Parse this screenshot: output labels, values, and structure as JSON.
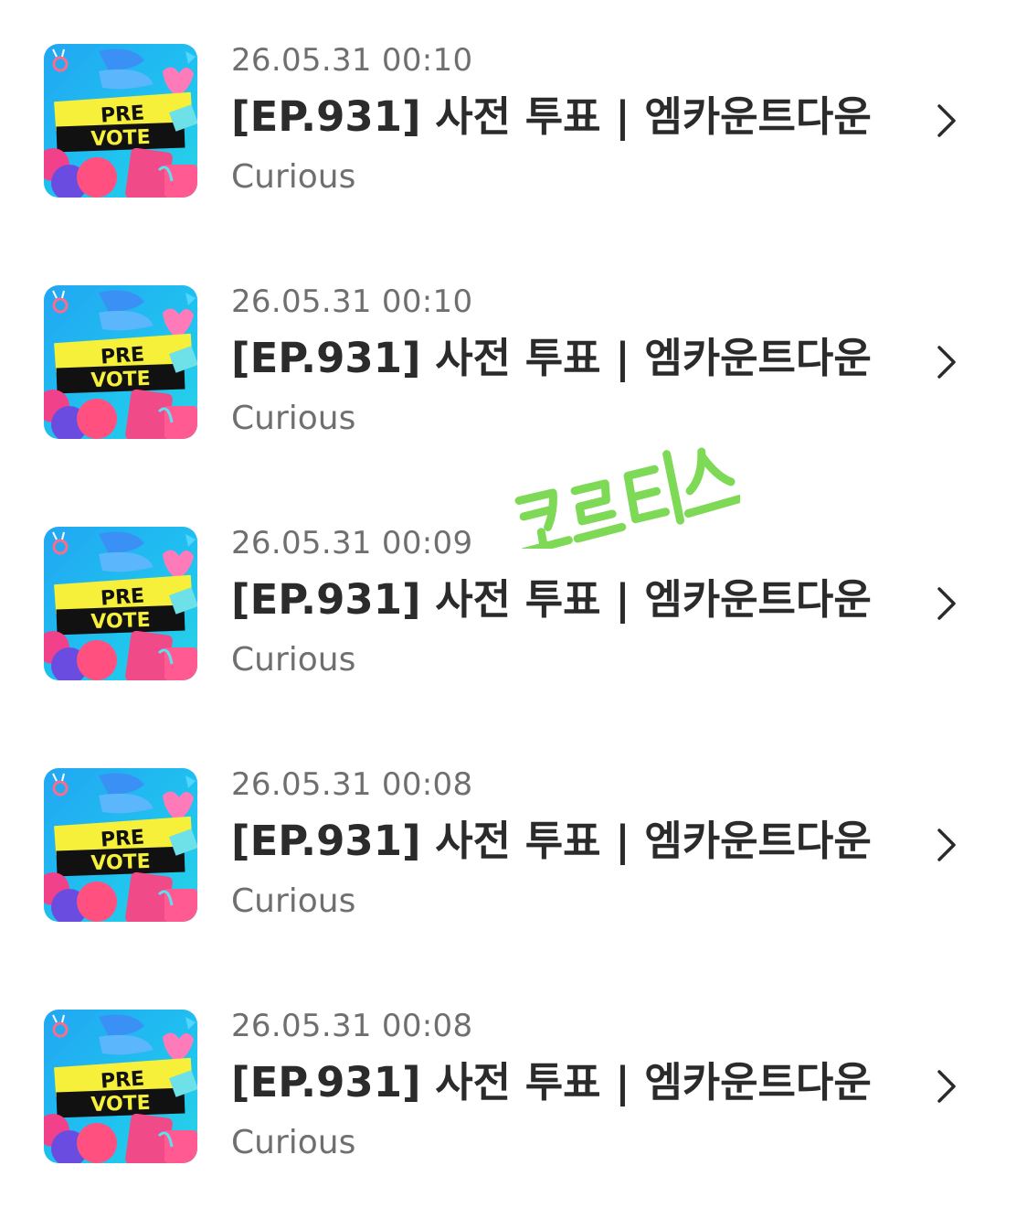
{
  "items": [
    {
      "thumbnail_text": [
        "PRE",
        "VOTE"
      ],
      "date": "26.05.31 00:10",
      "title": "[EP.931] 사전 투표 | 엠카운트다운",
      "artist": "Curious",
      "chevron_icon": "chevron-right-icon"
    },
    {
      "thumbnail_text": [
        "PRE",
        "VOTE"
      ],
      "date": "26.05.31 00:10",
      "title": "[EP.931] 사전 투표 | 엠카운트다운",
      "artist": "Curious",
      "chevron_icon": "chevron-right-icon"
    },
    {
      "thumbnail_text": [
        "PRE",
        "VOTE"
      ],
      "date": "26.05.31 00:09",
      "title": "[EP.931] 사전 투표 | 엠카운트다운",
      "artist": "Curious",
      "chevron_icon": "chevron-right-icon"
    },
    {
      "thumbnail_text": [
        "PRE",
        "VOTE"
      ],
      "date": "26.05.31 00:08",
      "title": "[EP.931] 사전 투표 | 엠카운트다운",
      "artist": "Curious",
      "chevron_icon": "chevron-right-icon"
    },
    {
      "thumbnail_text": [
        "PRE",
        "VOTE"
      ],
      "date": "26.05.31 00:08",
      "title": "[EP.931] 사전 투표 | 엠카운트다운",
      "artist": "Curious",
      "chevron_icon": "chevron-right-icon"
    }
  ],
  "watermark": {
    "text": "코르티스",
    "color": "#7ed957"
  },
  "colors": {
    "date_text": "#6f6f6f",
    "title_text": "#2b2b2b",
    "thumbnail_bg": "#1fb8f0",
    "thumbnail_banner_yellow": "#f6f03a",
    "thumbnail_banner_black": "#111111",
    "thumbnail_pink": "#f0418a",
    "thumbnail_purple": "#5b3bd6"
  }
}
